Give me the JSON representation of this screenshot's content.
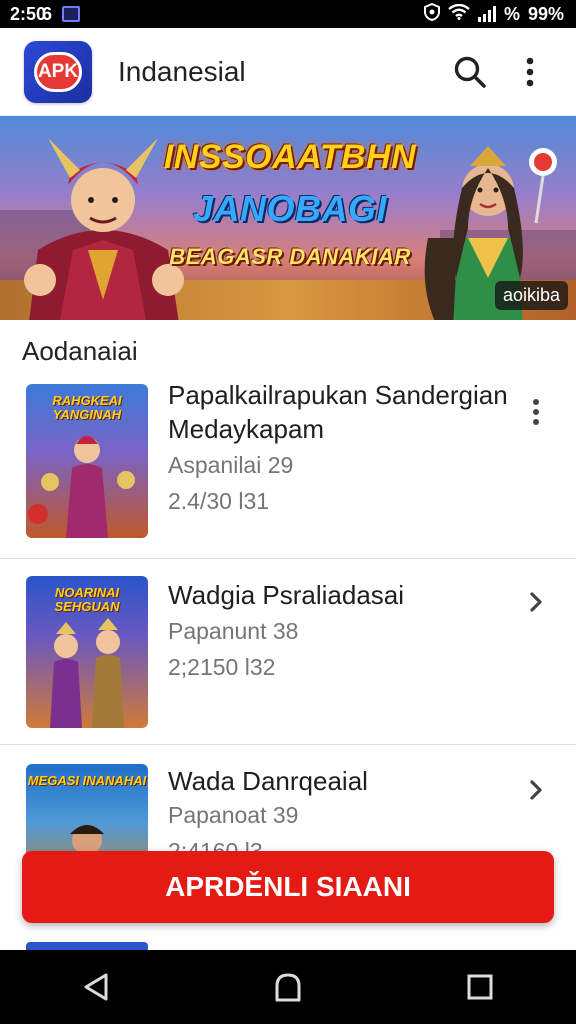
{
  "status_bar": {
    "time": "2:50 ",
    "time_suffix": "6",
    "battery": "99%",
    "pct_symbol": "%"
  },
  "app_bar": {
    "logo_text": "APK",
    "title": "Indanesial"
  },
  "banner": {
    "title_line1": "INSSOAATBHN",
    "title_line2": "JANOBAGI",
    "title_line3": "BEAGASR DANAKIAR",
    "badge": "aoikiba"
  },
  "section": {
    "title": "Aodanaiai"
  },
  "items": [
    {
      "thumb_label": "RAHGKEAI YANGINAH",
      "title": "Papalkailrapukan Sandergian Medaykapam",
      "subtitle1": "Aspanilai 29",
      "subtitle2": "2.4/30 l31"
    },
    {
      "thumb_label": "NOARINAI SEHGUAN",
      "title": "Wadgia Psraliadasai",
      "subtitle1": "Papanunt 38",
      "subtitle2": "2;2150 l32"
    },
    {
      "thumb_label": "MEGASI INANAHAI",
      "title": "Wada Danrqeaial",
      "subtitle1": "Papanoat 39",
      "subtitle2": "2;4160 l3"
    }
  ],
  "cta": {
    "label": "APRDĚNLI SIAANI"
  },
  "colors": {
    "accent": "#e31b14",
    "status_bar": "#000000",
    "text_primary": "#1f1f1f",
    "text_secondary": "#757575"
  }
}
